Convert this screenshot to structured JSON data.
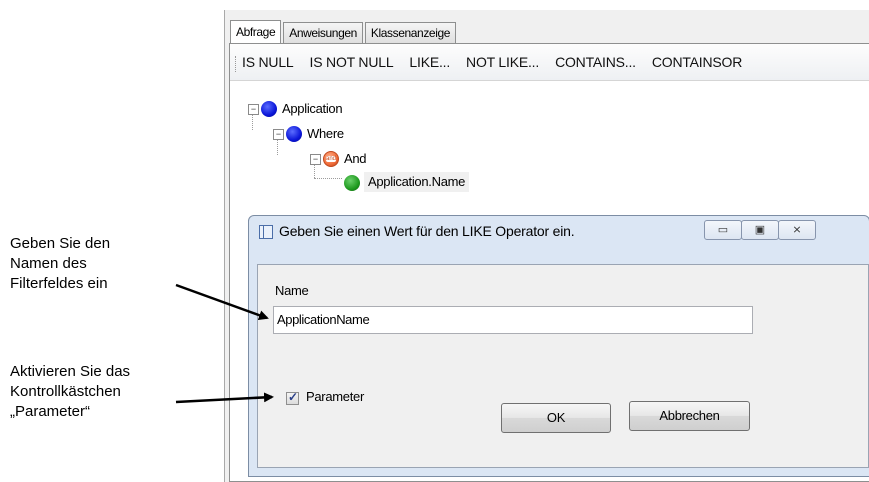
{
  "annotations": {
    "filter_name": [
      "Geben  Sie  den",
      "Namen  des",
      "Filterfeldes  ein"
    ],
    "parameter": [
      "Aktivieren  Sie das",
      "Kontrollkästchen",
      "„Parameter“"
    ]
  },
  "tabs": [
    "Abfrage",
    "Anweisungen",
    "Klassenanzeige"
  ],
  "toolbar": [
    "IS NULL",
    "IS NOT NULL",
    "LIKE...",
    "NOT LIKE...",
    "CONTAINS...",
    "CONTAINSOR"
  ],
  "tree": {
    "application": "Application",
    "where": "Where",
    "and": "And",
    "and_icon": "and",
    "field": "Application.Name"
  },
  "dialog": {
    "title": "Geben Sie einen Wert für den LIKE Operator ein.",
    "name_label": "Name",
    "name_value": "ApplicationName",
    "parameter_label": "Parameter",
    "parameter_checked": true,
    "ok_label": "OK",
    "cancel_label": "Abbrechen"
  },
  "window_buttons": {
    "minimize": "▭",
    "maximize": "▣",
    "close": "⨯"
  },
  "colors": {
    "node_blue": "#0b16d9",
    "node_green": "#1f9a1f",
    "node_orange": "#f06c3a",
    "dialog_frame": "#dbe6f4"
  }
}
